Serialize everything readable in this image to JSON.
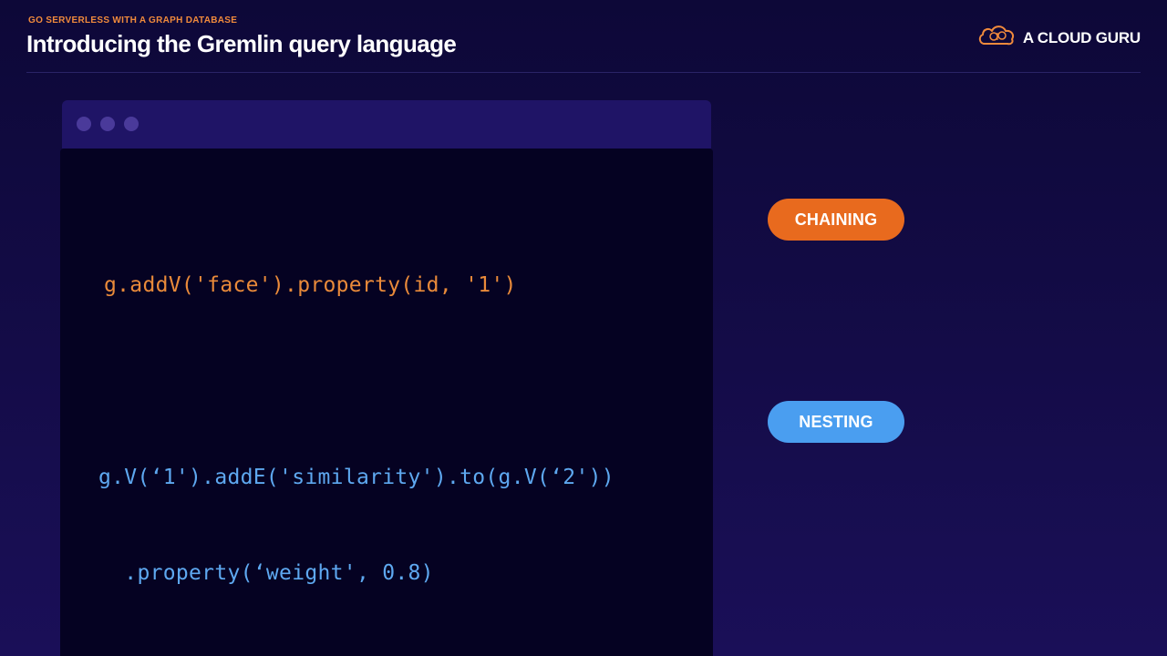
{
  "header": {
    "eyebrow": "GO SERVERLESS WITH A GRAPH DATABASE",
    "title": "Introducing the Gremlin query language"
  },
  "brand": {
    "name": "A CLOUD GURU",
    "icon": "cloud-logo-icon",
    "accent": "#f08a3c"
  },
  "code_window": {
    "dots": [
      "window-dot",
      "window-dot",
      "window-dot"
    ],
    "chaining_lines": [
      "g.addV('face').property(id, '1')"
    ],
    "nesting_lines": [
      "g.V(‘1').addE('similarity').to(g.V(‘2'))",
      "  .property(‘weight', 0.8)"
    ]
  },
  "labels": {
    "chaining": "CHAINING",
    "nesting": "NESTING"
  },
  "colors": {
    "chaining": "#e86a1e",
    "nesting": "#4a9ef0",
    "chaining_code": "#e98a3a",
    "nesting_code": "#5ea8f0",
    "background": "#0d0838"
  }
}
